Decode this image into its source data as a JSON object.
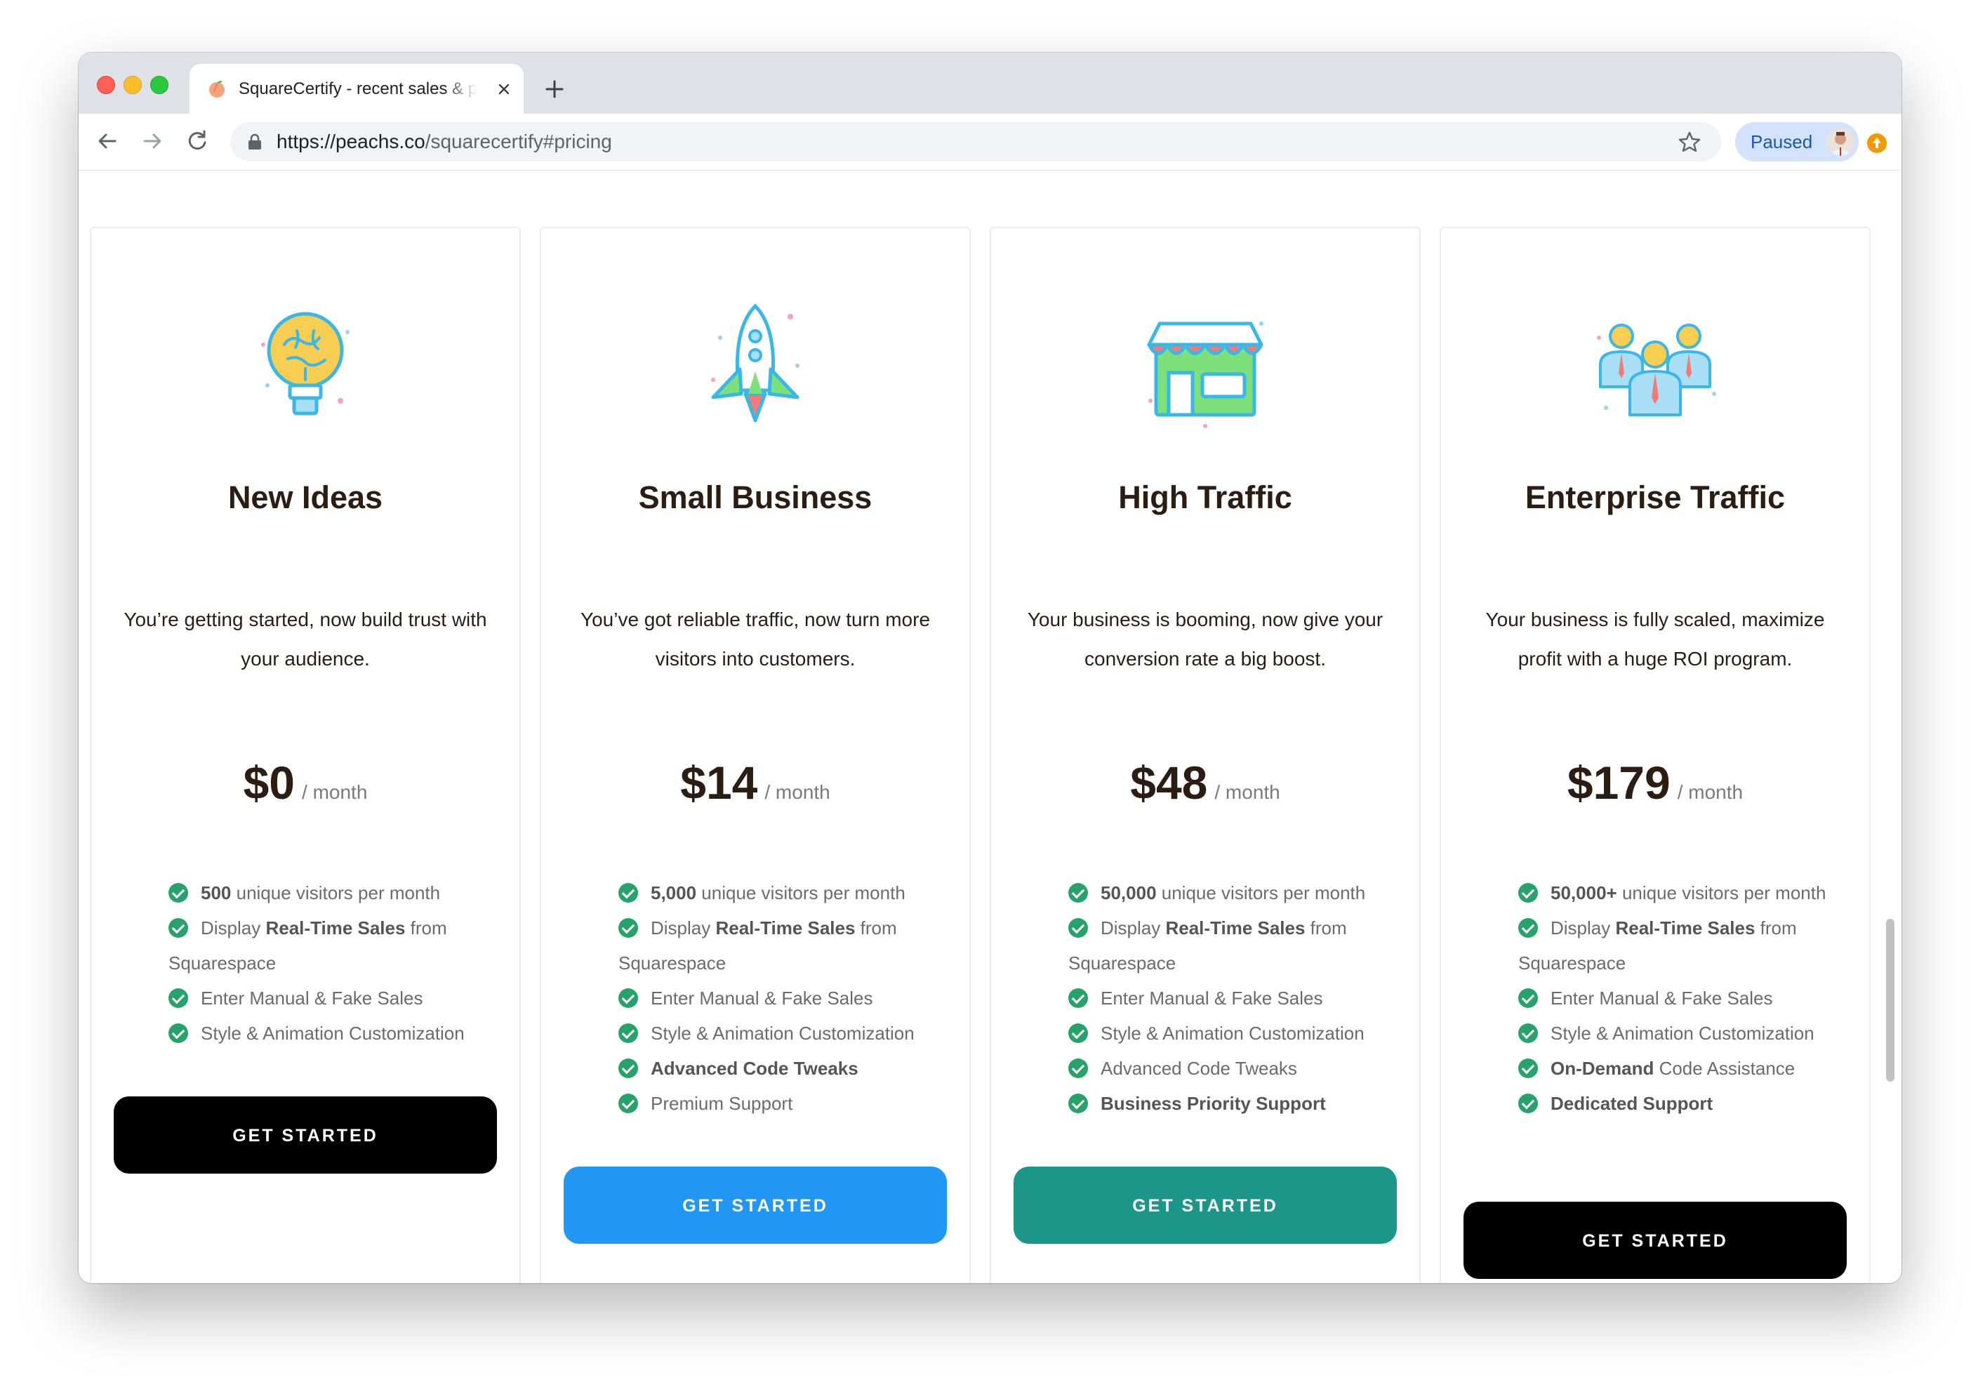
{
  "browser": {
    "tab_title": "SquareCertify - recent sales & popups",
    "url_host": "https://peachs.co",
    "url_path": "/squarecertify#pricing",
    "profile_label": "Paused"
  },
  "plans": [
    {
      "title": "New Ideas",
      "description": "You’re getting started, now build trust with your audience.",
      "price": "$0",
      "period": "/ month",
      "button_label": "GET STARTED",
      "button_color": "#000000",
      "icon": "lightbulb-brain-icon",
      "features": [
        {
          "bold": "500",
          "text": " unique visitors per month"
        },
        {
          "pre": "Display ",
          "bold": "Real-Time Sales",
          "text": " from Squarespace"
        },
        {
          "text": "Enter Manual & Fake Sales"
        },
        {
          "text": "Style & Animation Customization"
        }
      ]
    },
    {
      "title": "Small Business",
      "description": "You’ve got reliable traffic, now turn more visitors into customers.",
      "price": "$14",
      "period": "/ month",
      "button_label": "GET STARTED",
      "button_color": "#2196f3",
      "icon": "rocket-icon",
      "features": [
        {
          "bold": "5,000",
          "text": " unique visitors per month"
        },
        {
          "pre": "Display ",
          "bold": "Real-Time Sales",
          "text": " from Squarespace"
        },
        {
          "text": "Enter Manual & Fake Sales"
        },
        {
          "text": "Style & Animation Customization"
        },
        {
          "bold": "Advanced Code Tweaks"
        },
        {
          "text": "Premium Support"
        }
      ]
    },
    {
      "title": "High Traffic",
      "description": "Your business is booming, now give your conversion rate a big boost.",
      "price": "$48",
      "period": "/ month",
      "button_label": "GET STARTED",
      "button_color": "#1b9688",
      "icon": "storefront-icon",
      "features": [
        {
          "bold": "50,000",
          "text": " unique visitors per month"
        },
        {
          "pre": "Display ",
          "bold": "Real-Time Sales",
          "text": " from Squarespace"
        },
        {
          "text": "Enter Manual & Fake Sales"
        },
        {
          "text": "Style & Animation Customization"
        },
        {
          "text": "Advanced Code Tweaks"
        },
        {
          "bold": "Business Priority Support"
        }
      ]
    },
    {
      "title": "Enterprise Traffic",
      "description": "Your business is fully scaled, maximize profit with a huge ROI program.",
      "price": "$179",
      "period": "/ month",
      "button_label": "GET STARTED",
      "button_color": "#000000",
      "icon": "team-icon",
      "features": [
        {
          "bold": "50,000+",
          "text": " unique visitors per month"
        },
        {
          "pre": "Display ",
          "bold": "Real-Time Sales",
          "text": " from Squarespace"
        },
        {
          "text": "Enter Manual & Fake Sales"
        },
        {
          "text": "Style & Animation Customization"
        },
        {
          "bold": "On-Demand",
          "text": " Code Assistance"
        },
        {
          "bold": "Dedicated Support"
        }
      ]
    }
  ],
  "colors": {
    "check_green": "#26a26a",
    "title_brown": "#2b1d12"
  }
}
